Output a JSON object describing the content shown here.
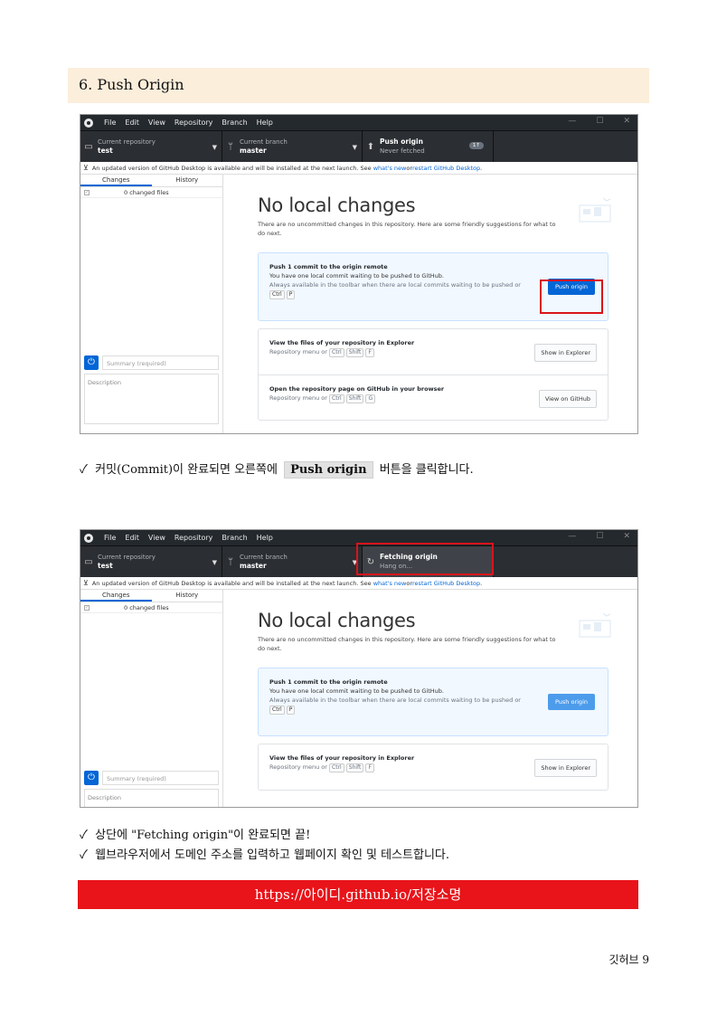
{
  "section": {
    "title": "6. Push Origin"
  },
  "app": {
    "menu": [
      "File",
      "Edit",
      "View",
      "Repository",
      "Branch",
      "Help"
    ],
    "window_controls": [
      "—",
      "☐",
      "✕"
    ],
    "repo": {
      "label": "Current repository",
      "value": "test"
    },
    "branch": {
      "label": "Current branch",
      "value": "master"
    },
    "notice": {
      "text": "An updated version of GitHub Desktop is available and will be installed at the next launch. See ",
      "link1": "what's new",
      "mid": " or ",
      "link2": "restart GitHub Desktop",
      "end": "."
    },
    "tabs": {
      "changes": "Changes",
      "history": "History"
    },
    "changed_files": "0 changed files",
    "summary_placeholder": "Summary (required)",
    "description_placeholder": "Description",
    "no_changes_title": "No local changes",
    "no_changes_sub": "There are no uncommitted changes in this repository. Here are some friendly suggestions for what to do next.",
    "push_card": {
      "title": "Push 1 commit to the origin remote",
      "line": "You have one local commit waiting to be pushed to GitHub.",
      "hint": "Always available in the toolbar when there are local commits waiting to be pushed or",
      "kbd1": "Ctrl",
      "kbd2": "P",
      "button": "Push origin"
    },
    "explorer_card": {
      "title": "View the files of your repository in Explorer",
      "hint": "Repository menu or",
      "kbd1": "Ctrl",
      "kbd2": "Shift",
      "kbd3": "F",
      "button": "Show in Explorer"
    },
    "github_card": {
      "title": "Open the repository page on GitHub in your browser",
      "hint": "Repository menu or",
      "kbd1": "Ctrl",
      "kbd2": "Shift",
      "kbd3": "G",
      "button": "View on GitHub"
    }
  },
  "shot1": {
    "push": {
      "title": "Push origin",
      "sub": "Never fetched",
      "badge": "1↑"
    }
  },
  "shot2": {
    "push": {
      "title": "Fetching origin",
      "sub": "Hang on..."
    }
  },
  "caption1": {
    "check": "✓",
    "before": "커밋(Commit)이 완료되면 오른쪽에",
    "button": "Push origin",
    "after": "버튼을 클릭합니다."
  },
  "caption2": {
    "check": "✓",
    "text": "상단에 \"Fetching origin\"이 완료되면 끝!"
  },
  "caption3": {
    "check": "✓",
    "text": "웹브라우저에서 도메인 주소를 입력하고 웹페이지 확인 및 테스트합니다."
  },
  "url": "https://아이디.github.io/저장소명",
  "footer": "깃허브 9",
  "colors": {
    "header_bg": "#fbeedb",
    "red": "#e8141a",
    "blue": "#0366d6"
  }
}
